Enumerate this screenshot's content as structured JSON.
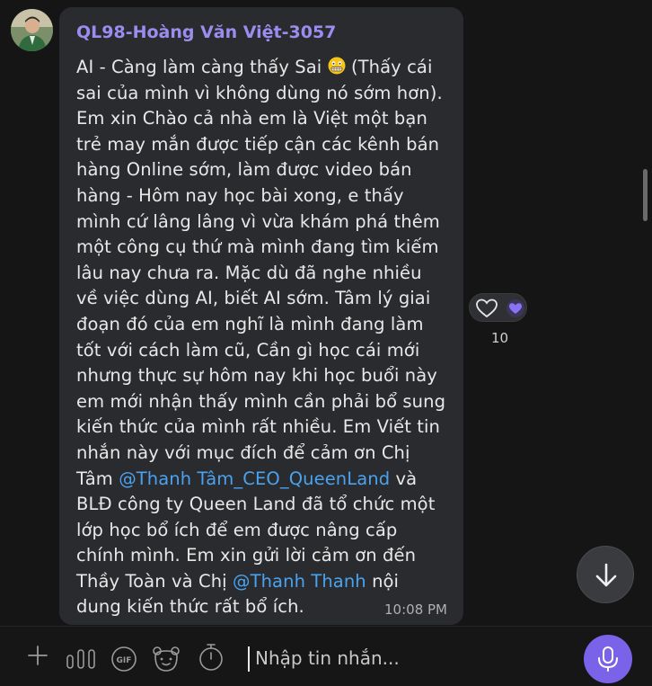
{
  "message": {
    "sender": "QL98-Hoàng Văn Việt-3057",
    "text_intro": "AI - Càng làm càng thấy Sai ",
    "text_part1": " (Thấy cái sai của mình vì không dùng nó sớm hơn). Em xin Chào cả nhà em là Việt một bạn trẻ may mắn được tiếp cận các kênh bán hàng Online sớm, làm được video bán hàng - Hôm nay học bài xong, e thấy mình cứ lâng lâng vì vừa khám phá thêm một công cụ thứ mà mình đang tìm kiếm lâu nay chưa ra. Mặc dù đã nghe nhiều về việc dùng AI, biết AI sớm. Tâm lý giai đoạn đó của em nghĩ là mình đang làm tốt với cách làm cũ, Cần gì học cái mới nhưng thực sự hôm nay khi học buổi này em mới nhận thấy mình cần phải bổ sung kiến thức của mình rất nhiều. Em Viết tin nhắn này với mục đích để cảm ơn Chị Tâm ",
    "mention1": "@Thanh Tâm_CEO_QueenLand",
    "text_part2": " và BLĐ công ty Queen Land đã tổ chức một lớp học bổ ích để em được nâng cấp chính mình. Em xin gửi lời cảm ơn đến Thầy Toàn và Chị ",
    "mention2": "@Thanh Thanh",
    "text_part3": " nội dung kiến thức rất bổ ích.",
    "time": "10:08 PM",
    "emoji": "grimacing-face-icon"
  },
  "reactions": {
    "count": "10",
    "icons": [
      "heart-outline-icon",
      "purple-heart-icon"
    ]
  },
  "composer": {
    "placeholder": "Nhập tin nhắn...",
    "gif_label": "GIF",
    "icons": [
      "plus-icon",
      "sound-bars-icon",
      "gif-icon",
      "sticker-bear-icon",
      "timer-icon",
      "microphone-icon"
    ]
  },
  "colors": {
    "accent": "#7b63e9",
    "sender": "#9d8cf0",
    "mention": "#4aa3f0",
    "bubble": "#2a2b2e",
    "background": "#151515"
  }
}
